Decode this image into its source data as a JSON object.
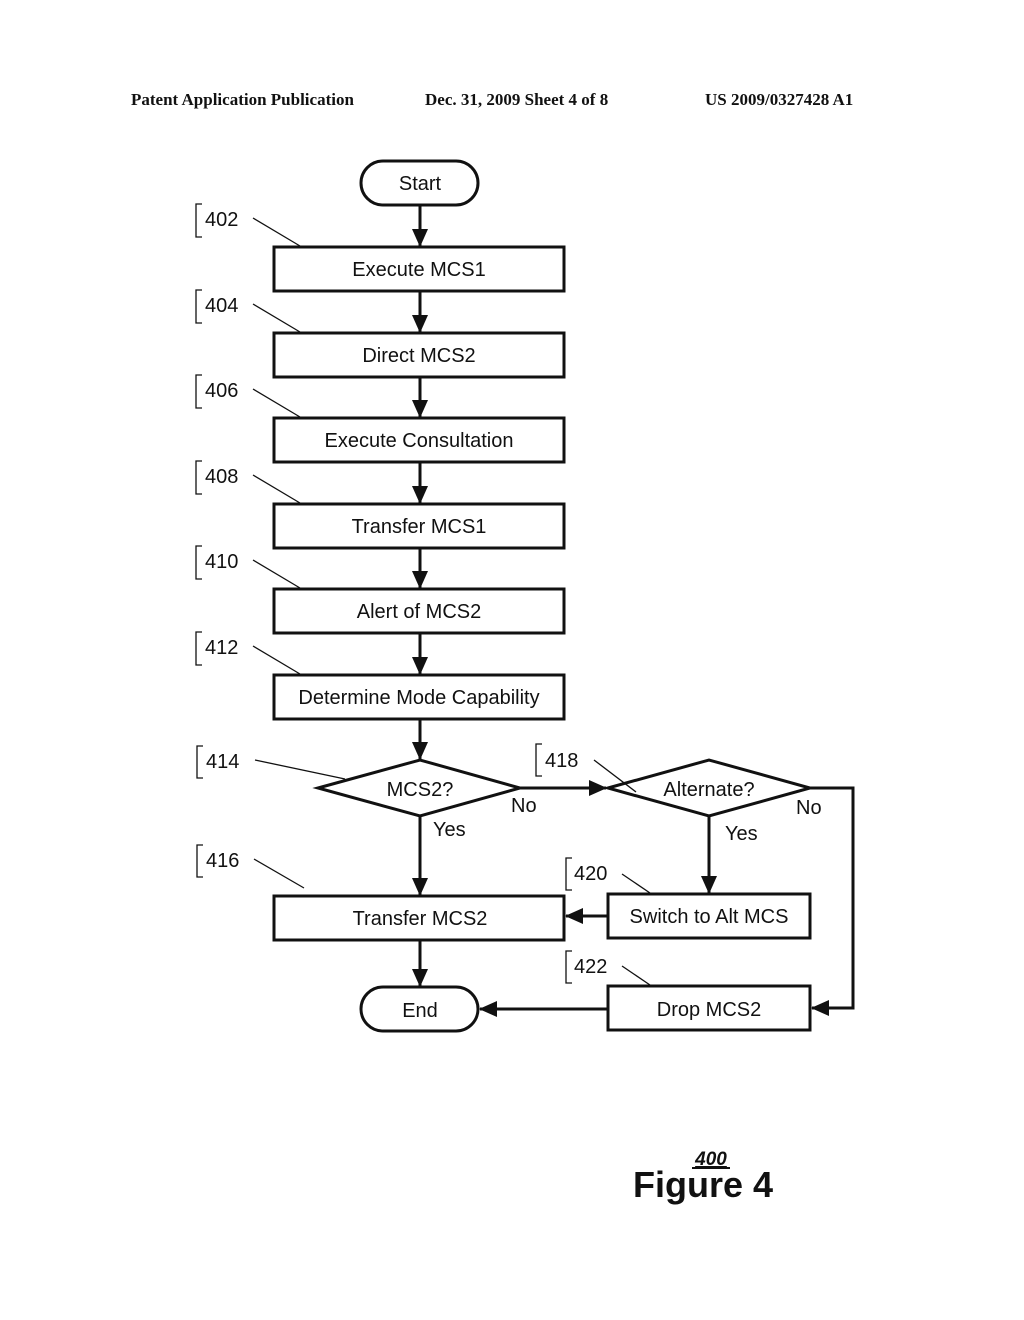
{
  "header": {
    "left": "Patent Application Publication",
    "center": "Dec. 31, 2009   Sheet 4 of 8",
    "right": "US 2009/0327428 A1"
  },
  "nodes": {
    "start": {
      "label": "Start"
    },
    "n402": {
      "ref": "402",
      "label": "Execute MCS1"
    },
    "n404": {
      "ref": "404",
      "label": "Direct MCS2"
    },
    "n406": {
      "ref": "406",
      "label": "Execute Consultation"
    },
    "n408": {
      "ref": "408",
      "label": "Transfer MCS1"
    },
    "n410": {
      "ref": "410",
      "label": "Alert of MCS2"
    },
    "n412": {
      "ref": "412",
      "label": "Determine Mode Capability"
    },
    "n414": {
      "ref": "414",
      "label": "MCS2?"
    },
    "n416": {
      "ref": "416",
      "label": "Transfer MCS2"
    },
    "n418": {
      "ref": "418",
      "label": "Alternate?"
    },
    "n420": {
      "ref": "420",
      "label": "Switch to Alt MCS"
    },
    "n422": {
      "ref": "422",
      "label": "Drop MCS2"
    },
    "end": {
      "label": "End"
    }
  },
  "edges": {
    "yes": "Yes",
    "no": "No"
  },
  "figure": {
    "number": "400",
    "title": "Figure 4"
  }
}
